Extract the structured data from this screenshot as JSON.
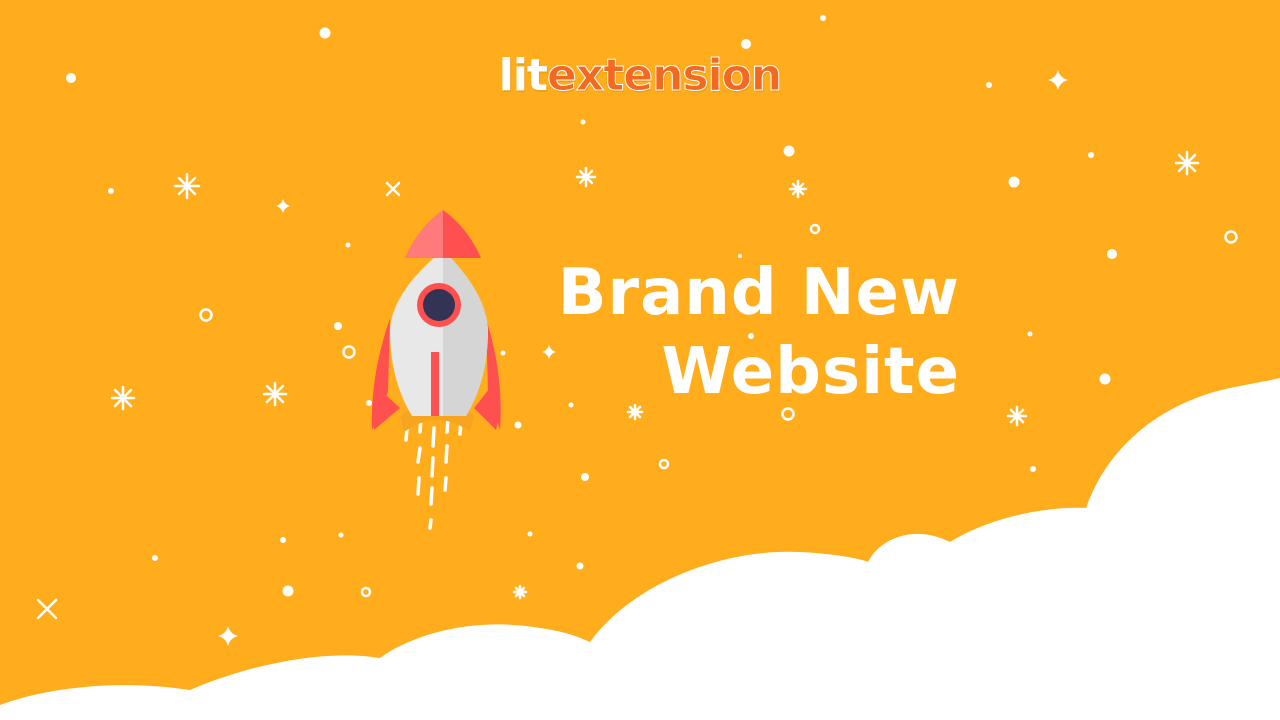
{
  "brand": {
    "part1": "lit",
    "part2": "extension"
  },
  "headline": {
    "line1": "Brand New",
    "line2": "Website"
  },
  "colors": {
    "background": "#FFAD1D",
    "cloud": "#FFFFFF",
    "rocket_body": "#E8E8E8",
    "rocket_accent": "#FF5050",
    "rocket_nose_light": "#FF7A7A",
    "window": "#333355",
    "brand_orange": "#F26A21"
  },
  "icons": [
    "rocket-icon",
    "star-icon",
    "cloud-shape"
  ]
}
